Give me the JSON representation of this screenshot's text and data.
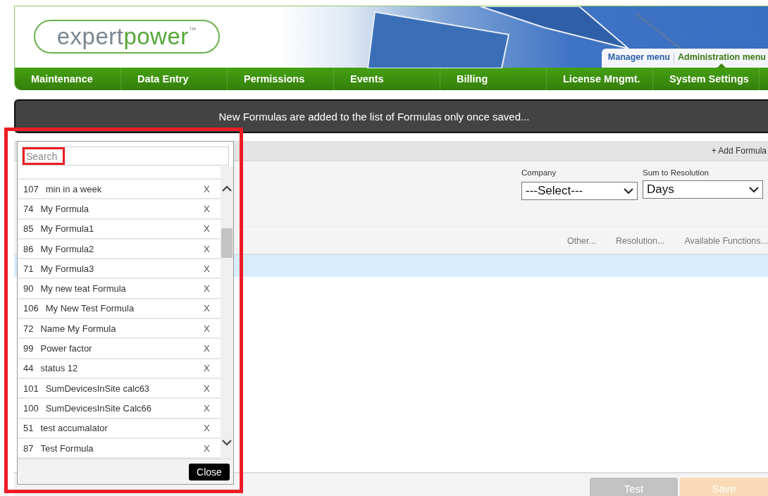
{
  "header": {
    "logo": {
      "text": "expert",
      "accent": "power",
      "mark": "™"
    },
    "menu_tabs": [
      {
        "label": "Manager menu",
        "selected": false
      },
      {
        "label": "Administration menu",
        "selected": true
      }
    ],
    "nav": [
      "Maintenance",
      "Data Entry",
      "Permissions",
      "Events",
      "Billing",
      "License Mngmt.",
      "System Settings"
    ]
  },
  "notice": "New Formulas are added to the list of Formulas only once saved...",
  "toolbar": {
    "add_link": "+ Add Formula"
  },
  "filters": [
    {
      "label": "Company",
      "value": "---Select---"
    },
    {
      "label": "Sum to Resolution",
      "value": "Days"
    }
  ],
  "links": [
    "Other...",
    "Resolution...",
    "Available Functions..."
  ],
  "buttons": [
    {
      "label": "Test",
      "kind": "secondary",
      "disabled": true
    },
    {
      "label": "Save",
      "kind": "primary",
      "disabled": true
    }
  ],
  "popup": {
    "search": {
      "placeholder": "Search"
    },
    "items": [
      {
        "id": "107",
        "name": "min in a week",
        "remove": "X"
      },
      {
        "id": "74",
        "name": "My Formula",
        "remove": "X"
      },
      {
        "id": "85",
        "name": "My Formula1",
        "remove": "X"
      },
      {
        "id": "86",
        "name": "My Formula2",
        "remove": "X"
      },
      {
        "id": "71",
        "name": "My Formula3",
        "remove": "X"
      },
      {
        "id": "90",
        "name": "My new teat Formula",
        "remove": "X"
      },
      {
        "id": "106",
        "name": "My New Test Formula",
        "remove": "X"
      },
      {
        "id": "72",
        "name": "Name My Formula",
        "remove": "X"
      },
      {
        "id": "99",
        "name": "Power factor",
        "remove": "X"
      },
      {
        "id": "44",
        "name": "status 12",
        "remove": "X"
      },
      {
        "id": "101",
        "name": "SumDevicesInSite calc63",
        "remove": "X"
      },
      {
        "id": "100",
        "name": "SumDevicesInSite Calc66",
        "remove": "X"
      },
      {
        "id": "51",
        "name": "test accumalator",
        "remove": "X"
      },
      {
        "id": "87",
        "name": "Test Formula",
        "remove": "X"
      }
    ],
    "close": "Close"
  }
}
